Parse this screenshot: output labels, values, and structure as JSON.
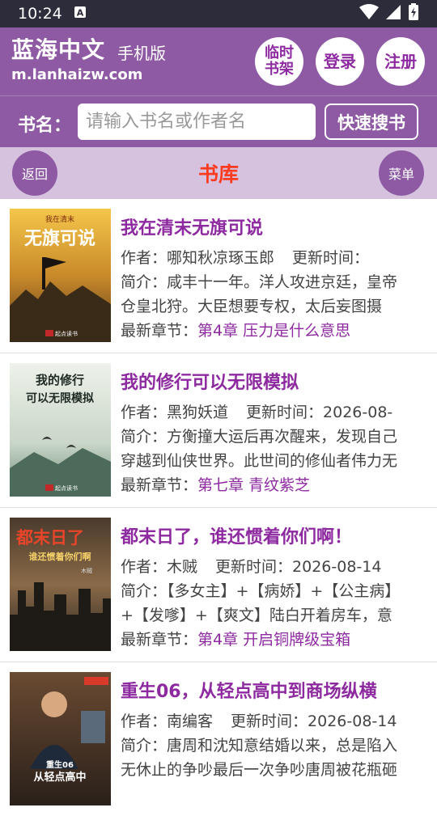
{
  "status": {
    "time": "10:24"
  },
  "header": {
    "logo_title": "蓝海中文",
    "logo_sub": "手机版",
    "logo_url": "m.lanhaizw.com",
    "btn_shelf_line1": "临时",
    "btn_shelf_line2": "书架",
    "btn_login": "登录",
    "btn_register": "注册"
  },
  "search": {
    "label": "书名：",
    "placeholder": "请输入书名或作者名",
    "button": "快速搜书"
  },
  "subnav": {
    "back": "返回",
    "title": "书库",
    "menu": "菜单"
  },
  "colors": {
    "brand": "#8e5aa3",
    "accent": "#8e2aa0",
    "title_red": "#ff3b1f"
  },
  "books": [
    {
      "title": "我在清末无旗可说",
      "author_label": "作者：",
      "author": "哪知秋凉琢玉郎",
      "update_label": "更新时间：",
      "update": "",
      "intro_label": "简介：",
      "intro1": "咸丰十一年。洋人攻进京廷，皇帝",
      "intro2": "仓皇北狩。大臣想要专权，太后妄图摄",
      "latest_label": "最新章节：",
      "latest": "第4章 压力是什么意思",
      "cover_text1": "我在清末",
      "cover_text2": "无旗可说",
      "cover_badge": "起点读书"
    },
    {
      "title": "我的修行可以无限模拟",
      "author_label": "作者：",
      "author": "黑狗妖道",
      "update_label": "更新时间：",
      "update": "2026-08-",
      "intro_label": "简介：",
      "intro1": "方衡撞大运后再次醒来，发现自己",
      "intro2": "穿越到仙侠世界。此世间的修仙者伟力无",
      "latest_label": "最新章节：",
      "latest": "第七章 青纹紫芝",
      "cover_text1": "我的修行",
      "cover_text2": "可以无限模拟",
      "cover_badge": "起点读书"
    },
    {
      "title": "都末日了，谁还惯着你们啊！",
      "author_label": "作者：",
      "author": "木贼",
      "update_label": "更新时间：",
      "update": "2026-08-14",
      "intro_label": "简介：",
      "intro1": "【多女主】+【病娇】+【公主病】",
      "intro2": "+【发嗲】+【爽文】陆白开着房车，意",
      "latest_label": "最新章节：",
      "latest": "第4章 开启铜牌级宝箱",
      "cover_text1": "都末日了",
      "cover_text2": "谁还惯着你们啊",
      "cover_badge": "木贼"
    },
    {
      "title": "重生06，从轻点高中到商场纵横",
      "author_label": "作者：",
      "author": "南编客",
      "update_label": "更新时间：",
      "update": "2026-08-14",
      "intro_label": "简介：",
      "intro1": "唐周和沈知意结婚以来，总是陷入",
      "intro2": "无休止的争吵最后一次争吵唐周被花瓶砸",
      "latest_label": "最新章节：",
      "latest": "",
      "cover_text1": "重生06",
      "cover_text2": "从轻点高中",
      "cover_badge": ""
    }
  ]
}
